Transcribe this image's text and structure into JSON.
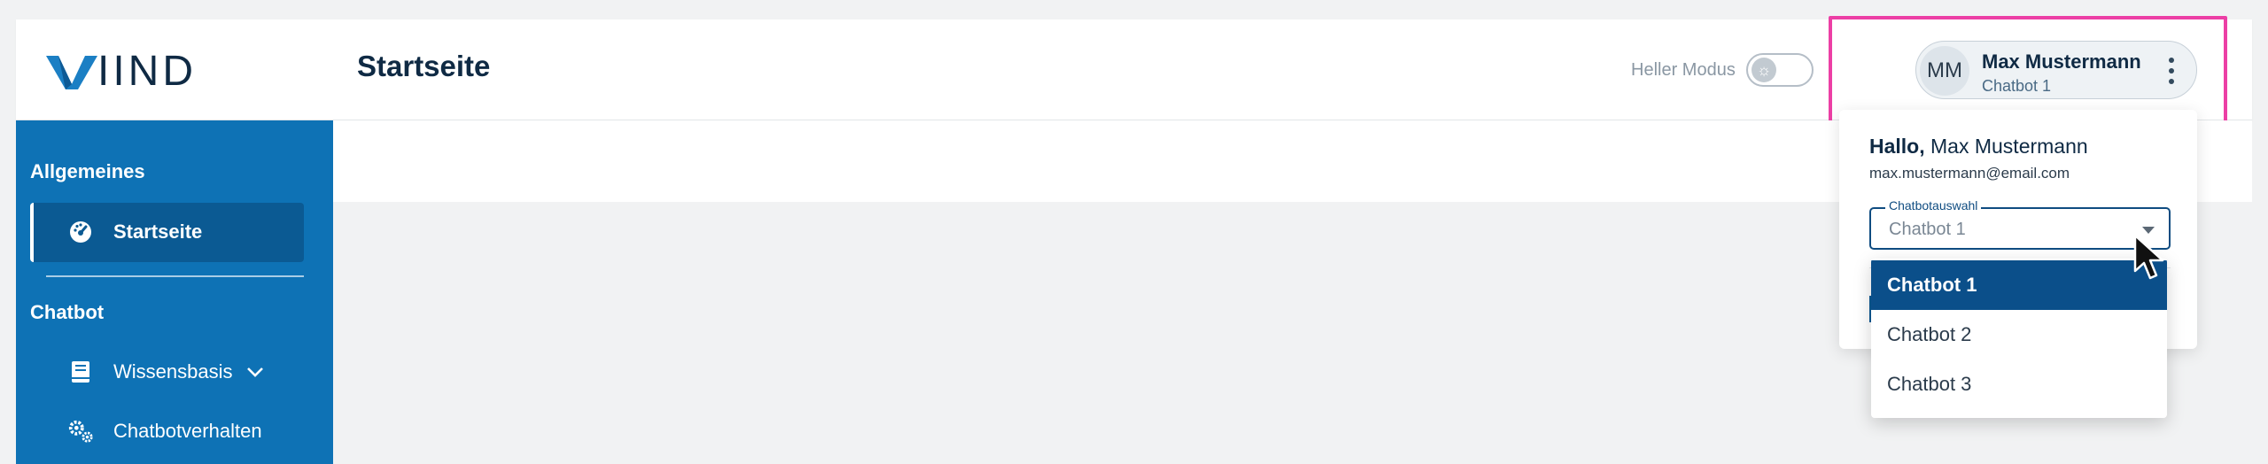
{
  "app": {
    "logo_text": "IIND",
    "page_title": "Startseite"
  },
  "header": {
    "mode_label": "Heller Modus",
    "mode_toggle_on": false,
    "mode_toggle_icon": "sun-icon"
  },
  "user": {
    "initials": "MM",
    "name": "Max Mustermann",
    "chatbot": "Chatbot 1"
  },
  "user_panel": {
    "greeting_bold": "Hallo,",
    "greeting_name": "Max Mustermann",
    "email": "max.mustermann@email.com",
    "select_label": "Chatbotauswahl",
    "select_value": "Chatbot 1",
    "options": [
      "Chatbot 1",
      "Chatbot 2",
      "Chatbot 3"
    ],
    "selected_index": 0
  },
  "sidebar": {
    "section_general": "Allgemeines",
    "item_home": "Startseite",
    "section_chatbot": "Chatbot",
    "item_knowledge": "Wissensbasis",
    "item_behavior": "Chatbotverhalten"
  },
  "colors": {
    "sidebar_bg": "#0e72b5",
    "sidebar_active": "#0b5a93",
    "highlight": "#ec3fa5",
    "selected_option": "#0b4f8a"
  }
}
